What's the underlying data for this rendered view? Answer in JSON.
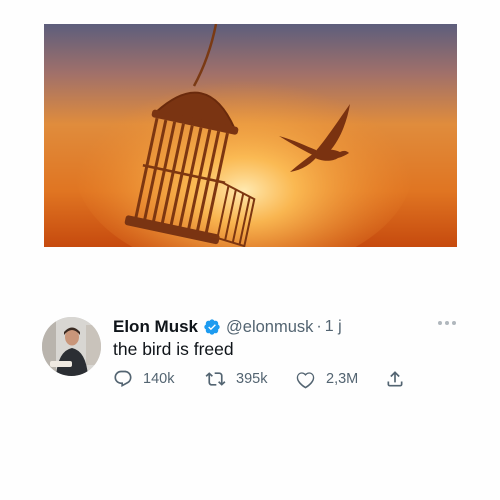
{
  "tweet": {
    "author_name": "Elon Musk",
    "handle": "@elonmusk",
    "separator": "·",
    "time": "1 j",
    "text": "the bird is freed",
    "verified": true,
    "verified_icon": "verified-badge-icon",
    "more_icon": "more-dots-icon",
    "actions": {
      "reply": {
        "icon": "reply-icon",
        "count": "140k"
      },
      "retweet": {
        "icon": "retweet-icon",
        "count": "395k"
      },
      "like": {
        "icon": "heart-icon",
        "count": "2,3M"
      },
      "share": {
        "icon": "share-icon"
      }
    }
  },
  "colors": {
    "text_primary": "#0f1419",
    "text_secondary": "#536471",
    "verified_blue": "#1d9bf0",
    "image_sky_top": "#5a5a78",
    "image_sky_glow": "#f6a436",
    "image_silhouette": "#6b2d0c"
  }
}
